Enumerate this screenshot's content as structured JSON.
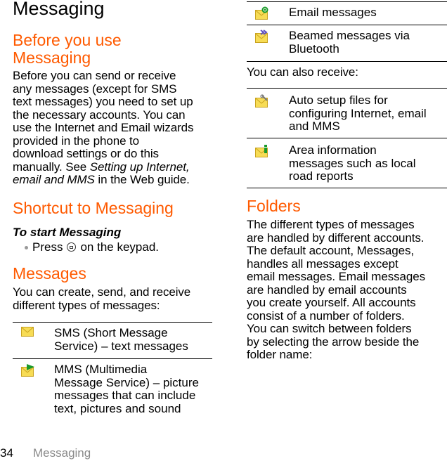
{
  "page": {
    "title": "Messaging",
    "footer": {
      "page_number": "34",
      "section": "Messaging"
    }
  },
  "colors": {
    "heading": "#ff5a00",
    "footer_text": "#8a8a8a",
    "envelope_yellow": "#f5d94a"
  },
  "sections": {
    "before_use": {
      "heading_line1": "Before you use",
      "heading_line2": "Messaging",
      "lines": [
        "Before you can send or receive",
        "any messages (except for SMS",
        "text messages) you need to set up",
        "the necessary accounts. You can",
        "use the Internet and Email wizards",
        "provided in the phone to",
        "download settings or do this"
      ],
      "line8_prefix": "manually. See ",
      "line8_italic": "Setting up Internet,",
      "line9_italic": "email and MMS",
      "line9_suffix": " in the Web guide."
    },
    "shortcut": {
      "heading": "Shortcut to Messaging",
      "subheading": "To start Messaging",
      "step_prefix": "Press",
      "step_icon": "message-key-icon",
      "step_suffix": "on the keypad."
    },
    "messages": {
      "heading": "Messages",
      "intro_lines": [
        "You can create, send, and receive",
        "different types of messages:"
      ],
      "types": [
        {
          "icon": "sms-envelope-icon",
          "lines": [
            "SMS (Short Message",
            "Service) – text messages"
          ]
        },
        {
          "icon": "mms-envelope-icon",
          "lines": [
            "MMS (Multimedia",
            "Message Service) – picture",
            "messages that can include",
            "text, pictures and sound"
          ]
        },
        {
          "icon": "email-envelope-icon",
          "lines": [
            "Email messages"
          ]
        },
        {
          "icon": "bluetooth-envelope-icon",
          "lines": [
            "Beamed messages via",
            "Bluetooth"
          ]
        }
      ],
      "also_receive": "You can also receive:",
      "also_types": [
        {
          "icon": "auto-setup-envelope-icon",
          "lines": [
            "Auto setup files for",
            "configuring Internet, email",
            "and MMS"
          ]
        },
        {
          "icon": "area-info-envelope-icon",
          "lines": [
            "Area information",
            "messages such as local",
            "road reports"
          ]
        }
      ]
    },
    "folders": {
      "heading": "Folders",
      "lines": [
        "The different types of messages",
        "are handled by different accounts.",
        "The default account, Messages,",
        "handles all messages except",
        "email messages. Email messages",
        "are handled by email accounts",
        "you create yourself. All accounts",
        "consist of a number of folders.",
        "You can switch between folders",
        "by selecting the arrow beside the",
        "folder name:"
      ]
    }
  }
}
